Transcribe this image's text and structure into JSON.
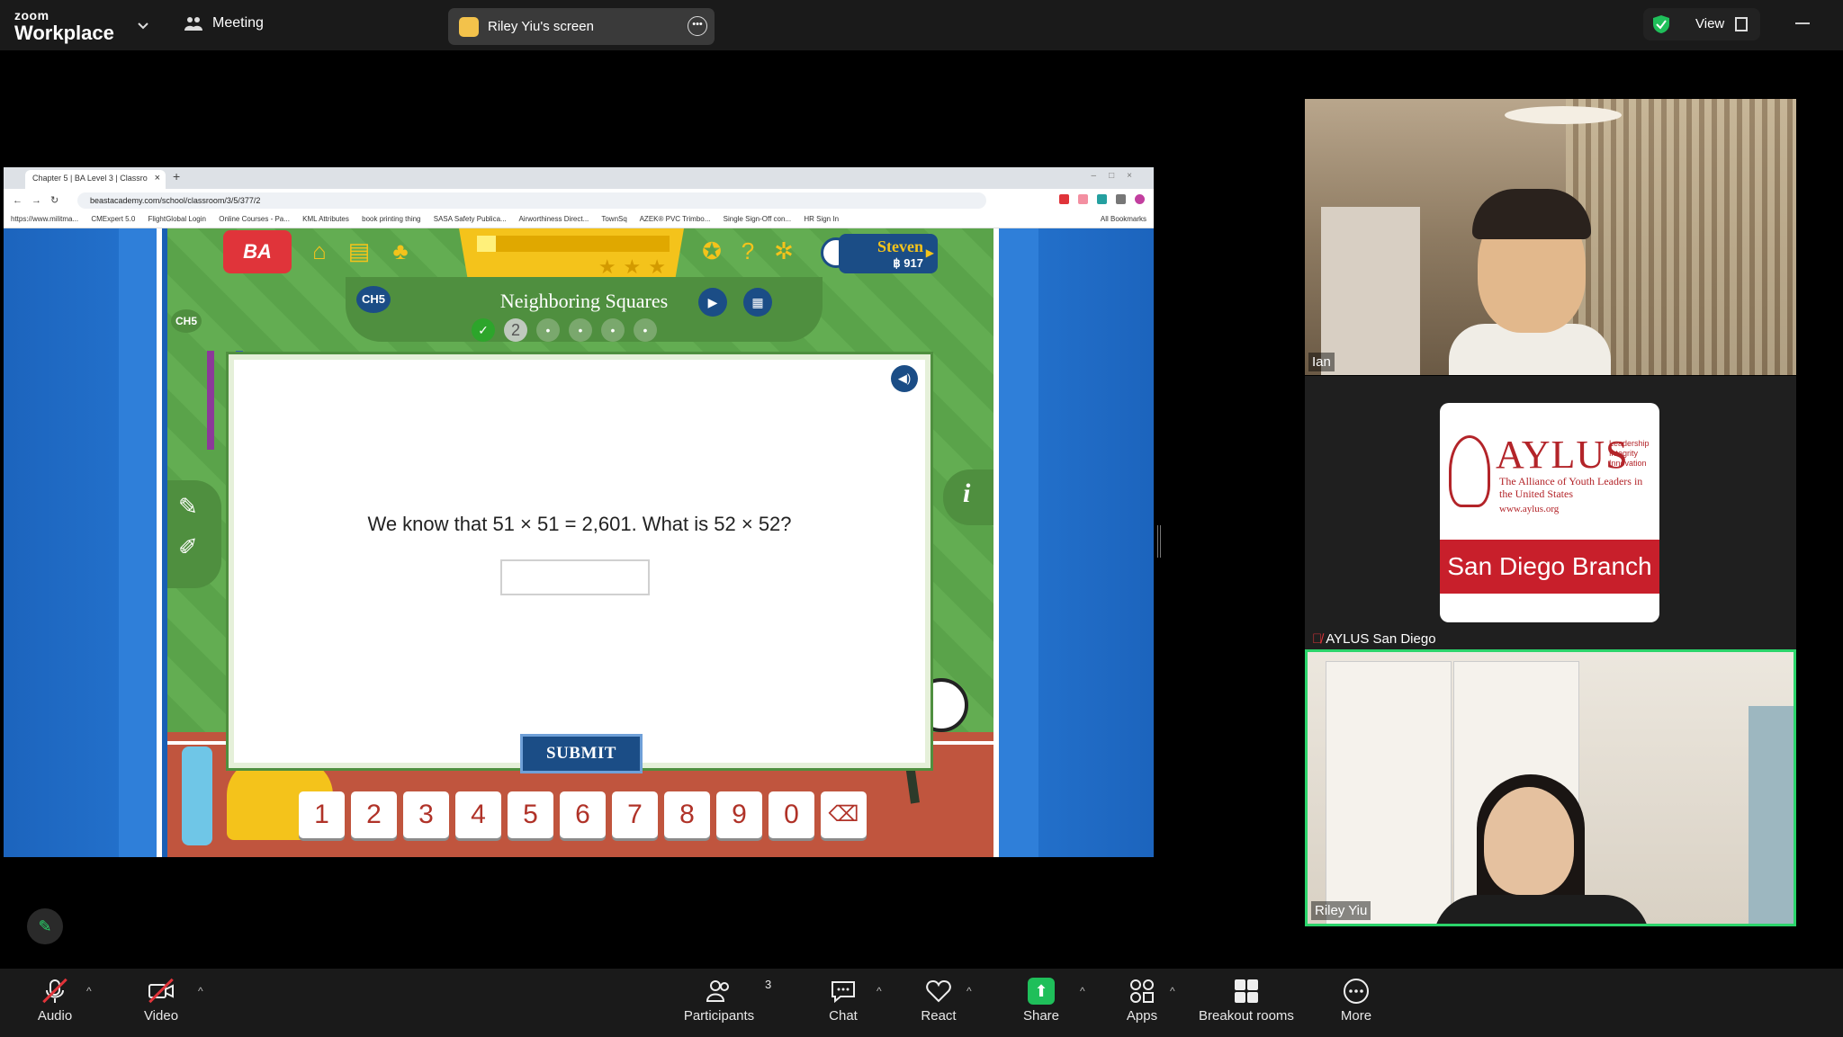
{
  "zoom": {
    "logo_line1": "zoom",
    "logo_line2": "Workplace",
    "meeting_label": "Meeting",
    "screen_share_label": "Riley Yiu's screen",
    "view_label": "View"
  },
  "browser": {
    "tab_title": "Chapter 5 | BA Level 3 | Classro",
    "url": "beastacademy.com/school/classroom/3/5/377/2",
    "bookmarks": [
      "https://www.militma...",
      "CMExpert 5.0",
      "FlightGlobal Login",
      "Online Courses - Pa...",
      "KML Attributes",
      "book printing thing",
      "SASA Safety Publica...",
      "Airworthiness Direct...",
      "TownSq",
      "AZEK® PVC Trimbo...",
      "Single Sign-Off con...",
      "HR Sign In"
    ],
    "all_bookmarks": "All Bookmarks"
  },
  "game": {
    "logo": "BA",
    "user_name": "Steven",
    "user_points": "฿ 917",
    "progress_fraction": 0.1,
    "chapter_badge": "CH5",
    "lesson_title": "Neighboring Squares",
    "current_question": "2",
    "question": "We know that 51 × 51 = 2,601. What is 52 × 52?",
    "answer_value": "",
    "submit_label": "SUBMIT",
    "numpad": [
      "1",
      "2",
      "3",
      "4",
      "5",
      "6",
      "7",
      "8",
      "9",
      "0"
    ],
    "info_label": "i"
  },
  "participants": [
    {
      "name": "Ian"
    },
    {
      "name": "AYLUS San Diego"
    },
    {
      "name": "Riley Yiu"
    }
  ],
  "aylus_card": {
    "big": "AYLUS",
    "tagline": "Leadership Integrity Innovation",
    "subtitle": "The Alliance of Youth Leaders in the United States",
    "url": "www.aylus.org",
    "branch": "San Diego Branch"
  },
  "controls": {
    "audio": "Audio",
    "video": "Video",
    "participants": "Participants",
    "participants_count": "3",
    "chat": "Chat",
    "react": "React",
    "share": "Share",
    "apps": "Apps",
    "breakout": "Breakout rooms",
    "more": "More"
  },
  "colors": {
    "accent_green": "#2bd46b",
    "ba_red": "#e0343a",
    "ba_blue": "#1b4d86",
    "ba_yellow": "#f4c31b"
  }
}
